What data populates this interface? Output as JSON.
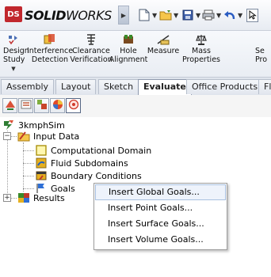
{
  "app": {
    "logo_mark": "DS",
    "logo_bold": "SOLID",
    "logo_light": "WORKS",
    "title_arrow_icon": "chevron-right-icon"
  },
  "quick_access": [
    {
      "name": "new-document",
      "icon": "new-document-icon"
    },
    {
      "name": "open",
      "icon": "open-folder-icon"
    },
    {
      "name": "save",
      "icon": "save-icon"
    },
    {
      "name": "print",
      "icon": "print-icon"
    },
    {
      "name": "undo",
      "icon": "undo-icon"
    },
    {
      "name": "select",
      "icon": "cursor-icon"
    }
  ],
  "ribbon": {
    "design_study": "Design Study",
    "interference_detection": "Interference Detection",
    "clearance_verification": "Clearance Verification",
    "hole_alignment": "Hole Alignment",
    "measure": "Measure",
    "mass_properties": "Mass Properties",
    "section_properties": "Se Pro"
  },
  "tabs": [
    {
      "label": "Assembly",
      "active": false
    },
    {
      "label": "Layout",
      "active": false
    },
    {
      "label": "Sketch",
      "active": false
    },
    {
      "label": "Evaluate",
      "active": true
    },
    {
      "label": "Office Products",
      "active": false
    },
    {
      "label": "Fl",
      "active": false
    }
  ],
  "manager_tabs": [
    {
      "name": "feature-manager",
      "icon": "feature-tree-icon"
    },
    {
      "name": "property-manager",
      "icon": "property-icon"
    },
    {
      "name": "configuration-manager",
      "icon": "configuration-icon"
    },
    {
      "name": "display-manager",
      "icon": "appearance-icon"
    },
    {
      "name": "flow-analysis",
      "icon": "flow-simulation-icon"
    }
  ],
  "tree": {
    "root": "3kmphSim",
    "input_data": "Input Data",
    "computational_domain": "Computational Domain",
    "fluid_subdomains": "Fluid Subdomains",
    "boundary_conditions": "Boundary Conditions",
    "goals": "Goals",
    "results": "Results"
  },
  "context_menu": {
    "items": [
      "Insert Global Goals...",
      "Insert Point Goals...",
      "Insert Surface Goals...",
      "Insert Volume Goals..."
    ],
    "highlighted_index": 0
  },
  "colors": {
    "brand_red": "#c1272d",
    "menu_highlight": "#eef3fb",
    "menu_highlight_border": "#a8c0e0"
  }
}
